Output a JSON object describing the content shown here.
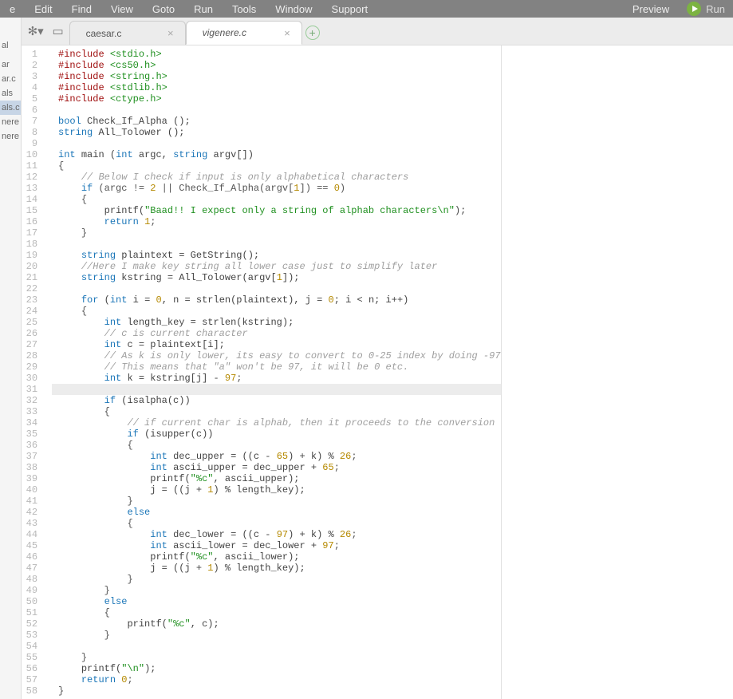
{
  "menu": {
    "items": [
      "e",
      "Edit",
      "Find",
      "View",
      "Goto",
      "Run",
      "Tools",
      "Window",
      "Support"
    ],
    "preview": "Preview",
    "run": "Run"
  },
  "tree": {
    "items": [
      "",
      "al",
      "",
      "ar",
      "ar.c",
      "als",
      "als.c",
      "nere",
      "nere"
    ],
    "active_index": 6
  },
  "tabs": {
    "list": [
      {
        "label": "caesar.c",
        "active": false
      },
      {
        "label": "vigenere.c",
        "active": true
      }
    ]
  },
  "editor": {
    "highlight_line": 31,
    "lines": [
      {
        "t": "inc",
        "text": "#include",
        "tail": "<stdio.h>"
      },
      {
        "t": "inc",
        "text": "#include",
        "tail": "<cs50.h>"
      },
      {
        "t": "inc",
        "text": "#include",
        "tail": "<string.h>"
      },
      {
        "t": "inc",
        "text": "#include",
        "tail": "<stdlib.h>"
      },
      {
        "t": "inc",
        "text": "#include",
        "tail": "<ctype.h>"
      },
      {
        "t": "blank"
      },
      {
        "t": "decl",
        "seg": [
          [
            "kw",
            "bool"
          ],
          [
            "sp",
            " "
          ],
          [
            "id",
            "Check_If_Alpha ();"
          ]
        ]
      },
      {
        "t": "decl",
        "seg": [
          [
            "kw",
            "string"
          ],
          [
            "sp",
            " "
          ],
          [
            "id",
            "All_Tolower ();"
          ]
        ]
      },
      {
        "t": "blank"
      },
      {
        "t": "decl",
        "seg": [
          [
            "kw",
            "int"
          ],
          [
            "sp",
            " "
          ],
          [
            "id",
            "main ("
          ],
          [
            "kw",
            "int"
          ],
          [
            "sp",
            " "
          ],
          [
            "id",
            "argc, "
          ],
          [
            "kw",
            "string"
          ],
          [
            "sp",
            " "
          ],
          [
            "id",
            "argv[])"
          ]
        ]
      },
      {
        "t": "plain",
        "seg": [
          [
            "pun",
            "{"
          ]
        ]
      },
      {
        "t": "cmt",
        "indent": 4,
        "text": "// Below I check if input is only alphabetical characters"
      },
      {
        "t": "plain",
        "indent": 4,
        "seg": [
          [
            "kw",
            "if"
          ],
          [
            "sp",
            " "
          ],
          [
            "pun",
            "(argc != "
          ],
          [
            "num",
            "2"
          ],
          [
            "pun",
            " || Check_If_Alpha(argv["
          ],
          [
            "num",
            "1"
          ],
          [
            "pun",
            "]) == "
          ],
          [
            "num",
            "0"
          ],
          [
            "pun",
            ")"
          ]
        ]
      },
      {
        "t": "plain",
        "indent": 4,
        "seg": [
          [
            "pun",
            "{"
          ]
        ]
      },
      {
        "t": "plain",
        "indent": 8,
        "seg": [
          [
            "id",
            "printf("
          ],
          [
            "str",
            "\"Baad!! I expect only a string of alphab characters\\n\""
          ],
          [
            "id",
            ");"
          ]
        ]
      },
      {
        "t": "plain",
        "indent": 8,
        "seg": [
          [
            "kw",
            "return"
          ],
          [
            "sp",
            " "
          ],
          [
            "num",
            "1"
          ],
          [
            "pun",
            ";"
          ]
        ]
      },
      {
        "t": "plain",
        "indent": 4,
        "seg": [
          [
            "pun",
            "}"
          ]
        ]
      },
      {
        "t": "blank"
      },
      {
        "t": "plain",
        "indent": 4,
        "seg": [
          [
            "kw",
            "string"
          ],
          [
            "sp",
            " "
          ],
          [
            "id",
            "plaintext = GetString();"
          ]
        ]
      },
      {
        "t": "cmt",
        "indent": 4,
        "text": "//Here I make key string all lower case just to simplify later"
      },
      {
        "t": "plain",
        "indent": 4,
        "seg": [
          [
            "kw",
            "string"
          ],
          [
            "sp",
            " "
          ],
          [
            "id",
            "kstring = All_Tolower(argv["
          ],
          [
            "num",
            "1"
          ],
          [
            "id",
            "]);"
          ]
        ]
      },
      {
        "t": "blank"
      },
      {
        "t": "plain",
        "indent": 4,
        "seg": [
          [
            "kw",
            "for"
          ],
          [
            "sp",
            " ("
          ],
          [
            "kw",
            "int"
          ],
          [
            "sp",
            " "
          ],
          [
            "id",
            "i = "
          ],
          [
            "num",
            "0"
          ],
          [
            "id",
            ", n = strlen(plaintext), j = "
          ],
          [
            "num",
            "0"
          ],
          [
            "id",
            "; i < n; i++)"
          ]
        ]
      },
      {
        "t": "plain",
        "indent": 4,
        "seg": [
          [
            "pun",
            "{"
          ]
        ]
      },
      {
        "t": "plain",
        "indent": 8,
        "seg": [
          [
            "kw",
            "int"
          ],
          [
            "sp",
            " "
          ],
          [
            "id",
            "length_key = strlen(kstring);"
          ]
        ]
      },
      {
        "t": "cmt",
        "indent": 8,
        "text": "// c is current character"
      },
      {
        "t": "plain",
        "indent": 8,
        "seg": [
          [
            "kw",
            "int"
          ],
          [
            "sp",
            " "
          ],
          [
            "id",
            "c = plaintext[i];"
          ]
        ]
      },
      {
        "t": "cmt",
        "indent": 8,
        "text": "// As k is only lower, its easy to convert to 0-25 index by doing -97"
      },
      {
        "t": "cmt",
        "indent": 8,
        "text": "// This means that \"a\" won't be 97, it will be 0 etc."
      },
      {
        "t": "plain",
        "indent": 8,
        "seg": [
          [
            "kw",
            "int"
          ],
          [
            "sp",
            " "
          ],
          [
            "id",
            "k = kstring[j] - "
          ],
          [
            "num",
            "97"
          ],
          [
            "pun",
            ";"
          ]
        ]
      },
      {
        "t": "blank"
      },
      {
        "t": "plain",
        "indent": 8,
        "seg": [
          [
            "kw",
            "if"
          ],
          [
            "sp",
            " "
          ],
          [
            "id",
            "(isalpha(c))"
          ]
        ]
      },
      {
        "t": "plain",
        "indent": 8,
        "seg": [
          [
            "pun",
            "{"
          ]
        ]
      },
      {
        "t": "cmt",
        "indent": 12,
        "text": "// if current char is alphab, then it proceeds to the conversion"
      },
      {
        "t": "plain",
        "indent": 12,
        "seg": [
          [
            "kw",
            "if"
          ],
          [
            "sp",
            " "
          ],
          [
            "id",
            "(isupper(c))"
          ]
        ]
      },
      {
        "t": "plain",
        "indent": 12,
        "seg": [
          [
            "pun",
            "{"
          ]
        ]
      },
      {
        "t": "plain",
        "indent": 16,
        "seg": [
          [
            "kw",
            "int"
          ],
          [
            "sp",
            " "
          ],
          [
            "id",
            "dec_upper = ((c - "
          ],
          [
            "num",
            "65"
          ],
          [
            "id",
            ") + k) % "
          ],
          [
            "num",
            "26"
          ],
          [
            "pun",
            ";"
          ]
        ]
      },
      {
        "t": "plain",
        "indent": 16,
        "seg": [
          [
            "kw",
            "int"
          ],
          [
            "sp",
            " "
          ],
          [
            "id",
            "ascii_upper = dec_upper + "
          ],
          [
            "num",
            "65"
          ],
          [
            "pun",
            ";"
          ]
        ]
      },
      {
        "t": "plain",
        "indent": 16,
        "seg": [
          [
            "id",
            "printf("
          ],
          [
            "str",
            "\"%c\""
          ],
          [
            "id",
            ", ascii_upper);"
          ]
        ]
      },
      {
        "t": "plain",
        "indent": 16,
        "seg": [
          [
            "id",
            "j = ((j + "
          ],
          [
            "num",
            "1"
          ],
          [
            "id",
            ") % length_key);"
          ]
        ]
      },
      {
        "t": "plain",
        "indent": 12,
        "seg": [
          [
            "pun",
            "}"
          ]
        ]
      },
      {
        "t": "plain",
        "indent": 12,
        "seg": [
          [
            "kw",
            "else"
          ]
        ]
      },
      {
        "t": "plain",
        "indent": 12,
        "seg": [
          [
            "pun",
            "{"
          ]
        ]
      },
      {
        "t": "plain",
        "indent": 16,
        "seg": [
          [
            "kw",
            "int"
          ],
          [
            "sp",
            " "
          ],
          [
            "id",
            "dec_lower = ((c - "
          ],
          [
            "num",
            "97"
          ],
          [
            "id",
            ") + k) % "
          ],
          [
            "num",
            "26"
          ],
          [
            "pun",
            ";"
          ]
        ]
      },
      {
        "t": "plain",
        "indent": 16,
        "seg": [
          [
            "kw",
            "int"
          ],
          [
            "sp",
            " "
          ],
          [
            "id",
            "ascii_lower = dec_lower + "
          ],
          [
            "num",
            "97"
          ],
          [
            "pun",
            ";"
          ]
        ]
      },
      {
        "t": "plain",
        "indent": 16,
        "seg": [
          [
            "id",
            "printf("
          ],
          [
            "str",
            "\"%c\""
          ],
          [
            "id",
            ", ascii_lower);"
          ]
        ]
      },
      {
        "t": "plain",
        "indent": 16,
        "seg": [
          [
            "id",
            "j = ((j + "
          ],
          [
            "num",
            "1"
          ],
          [
            "id",
            ") % length_key);"
          ]
        ]
      },
      {
        "t": "plain",
        "indent": 12,
        "seg": [
          [
            "pun",
            "}"
          ]
        ]
      },
      {
        "t": "plain",
        "indent": 8,
        "seg": [
          [
            "pun",
            "}"
          ]
        ]
      },
      {
        "t": "plain",
        "indent": 8,
        "seg": [
          [
            "kw",
            "else"
          ]
        ]
      },
      {
        "t": "plain",
        "indent": 8,
        "seg": [
          [
            "pun",
            "{"
          ]
        ]
      },
      {
        "t": "plain",
        "indent": 12,
        "seg": [
          [
            "id",
            "printf("
          ],
          [
            "str",
            "\"%c\""
          ],
          [
            "id",
            ", c);"
          ]
        ]
      },
      {
        "t": "plain",
        "indent": 8,
        "seg": [
          [
            "pun",
            "}"
          ]
        ]
      },
      {
        "t": "blank"
      },
      {
        "t": "plain",
        "indent": 4,
        "seg": [
          [
            "pun",
            "}"
          ]
        ]
      },
      {
        "t": "plain",
        "indent": 4,
        "seg": [
          [
            "id",
            "printf("
          ],
          [
            "str",
            "\"\\n\""
          ],
          [
            "id",
            ");"
          ]
        ]
      },
      {
        "t": "plain",
        "indent": 4,
        "seg": [
          [
            "kw",
            "return"
          ],
          [
            "sp",
            " "
          ],
          [
            "num",
            "0"
          ],
          [
            "pun",
            ";"
          ]
        ]
      },
      {
        "t": "plain",
        "seg": [
          [
            "pun",
            "}"
          ]
        ]
      }
    ]
  }
}
